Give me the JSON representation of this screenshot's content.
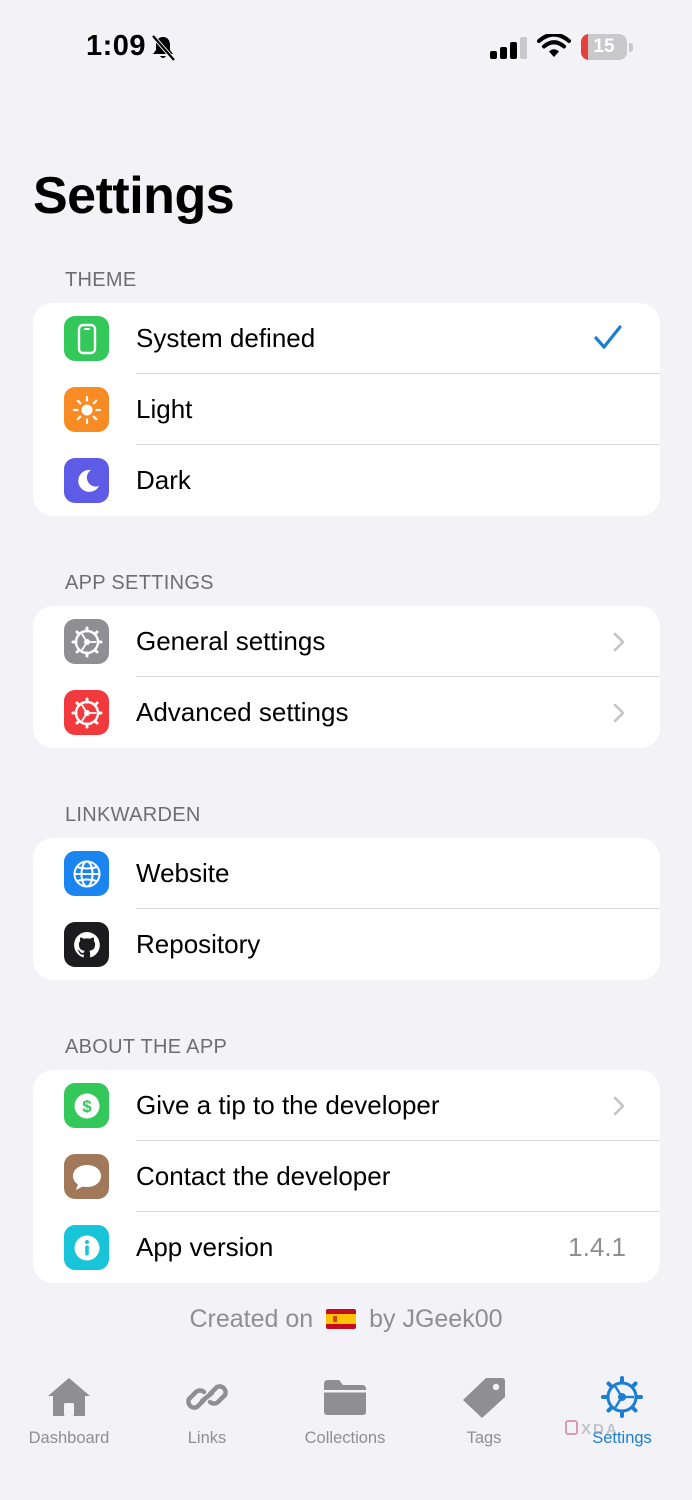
{
  "status_bar": {
    "time": "1:09",
    "battery_level": "15",
    "battery_fraction": 0.15,
    "battery_color": "#e5403a",
    "icons": [
      "bell-slash-icon",
      "cellular-signal-icon",
      "wifi-icon",
      "battery-icon"
    ]
  },
  "page": {
    "title": "Settings"
  },
  "sections": {
    "theme": {
      "header": "THEME",
      "items": [
        {
          "label": "System defined",
          "icon": "iphone-icon",
          "icon_color": "#34c759",
          "selected": true
        },
        {
          "label": "Light",
          "icon": "sun-icon",
          "icon_color": "#f98b25"
        },
        {
          "label": "Dark",
          "icon": "moon-icon",
          "icon_color": "#5e5ce6"
        }
      ]
    },
    "app_settings": {
      "header": "APP SETTINGS",
      "items": [
        {
          "label": "General settings",
          "icon": "gear-icon",
          "icon_color": "#8e8e93"
        },
        {
          "label": "Advanced settings",
          "icon": "gear-icon",
          "icon_color": "#f2393e"
        }
      ]
    },
    "linkwarden": {
      "header": "LINKWARDEN",
      "items": [
        {
          "label": "Website",
          "icon": "globe-icon",
          "icon_color": "#1a84f0"
        },
        {
          "label": "Repository",
          "icon": "github-icon",
          "icon_color": "#1c1c1e"
        }
      ]
    },
    "about": {
      "header": "ABOUT THE APP",
      "items": [
        {
          "label": "Give a tip to the developer",
          "icon": "dollar-icon",
          "icon_color": "#34c759"
        },
        {
          "label": "Contact the developer",
          "icon": "message-bubble-icon",
          "icon_color": "#a2785a"
        },
        {
          "label": "App version",
          "icon": "info-icon",
          "icon_color": "#18c4d8",
          "value": "1.4.1"
        }
      ]
    }
  },
  "footer": {
    "prefix": "Created on",
    "flag": "spain-flag-icon",
    "suffix": "by JGeek00"
  },
  "tabbar": {
    "tabs": [
      {
        "label": "Dashboard",
        "icon": "house-icon"
      },
      {
        "label": "Links",
        "icon": "link-icon"
      },
      {
        "label": "Collections",
        "icon": "folder-icon"
      },
      {
        "label": "Tags",
        "icon": "tag-icon"
      },
      {
        "label": "Settings",
        "icon": "gear-icon",
        "active": true
      }
    ],
    "accent": "#1a7fd4",
    "inactive": "#8e8e93"
  },
  "watermark": "XDA"
}
